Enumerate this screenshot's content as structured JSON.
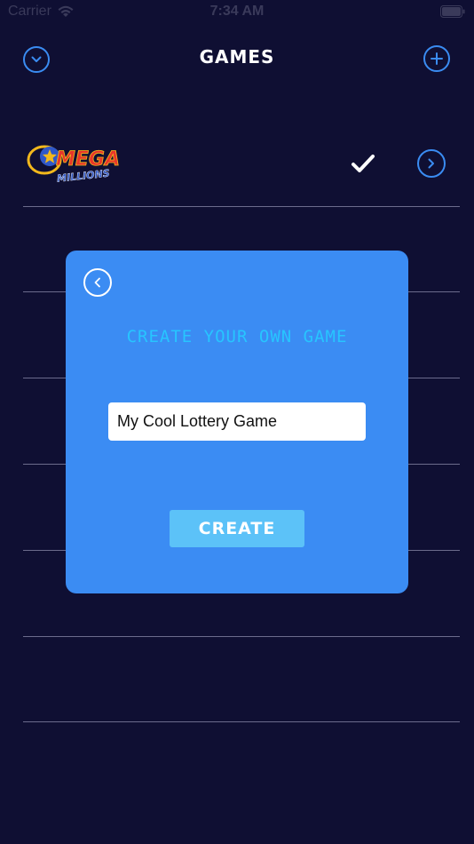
{
  "status_bar": {
    "carrier": "Carrier",
    "time": "7:34 AM",
    "wifi_icon": "wifi-icon",
    "battery_icon": "battery-icon"
  },
  "header": {
    "title": "GAMES",
    "left_icon": "chevron-down-icon",
    "right_icon": "plus-icon"
  },
  "games": [
    {
      "logo_text_top": "MEGA",
      "logo_text_bottom": "MILLIONS",
      "selected": true,
      "selected_icon": "checkmark-icon",
      "action_icon": "chevron-right-icon"
    }
  ],
  "modal": {
    "title": "CREATE YOUR OWN GAME",
    "back_icon": "chevron-left-icon",
    "input_value": "My Cool Lottery Game",
    "create_label": "CREATE"
  },
  "colors": {
    "background": "#0f0f33",
    "accent": "#3a8cf2",
    "modal": "#3b8cf3",
    "modal_title": "#27c5ff",
    "create_button": "#5cc2f8"
  }
}
